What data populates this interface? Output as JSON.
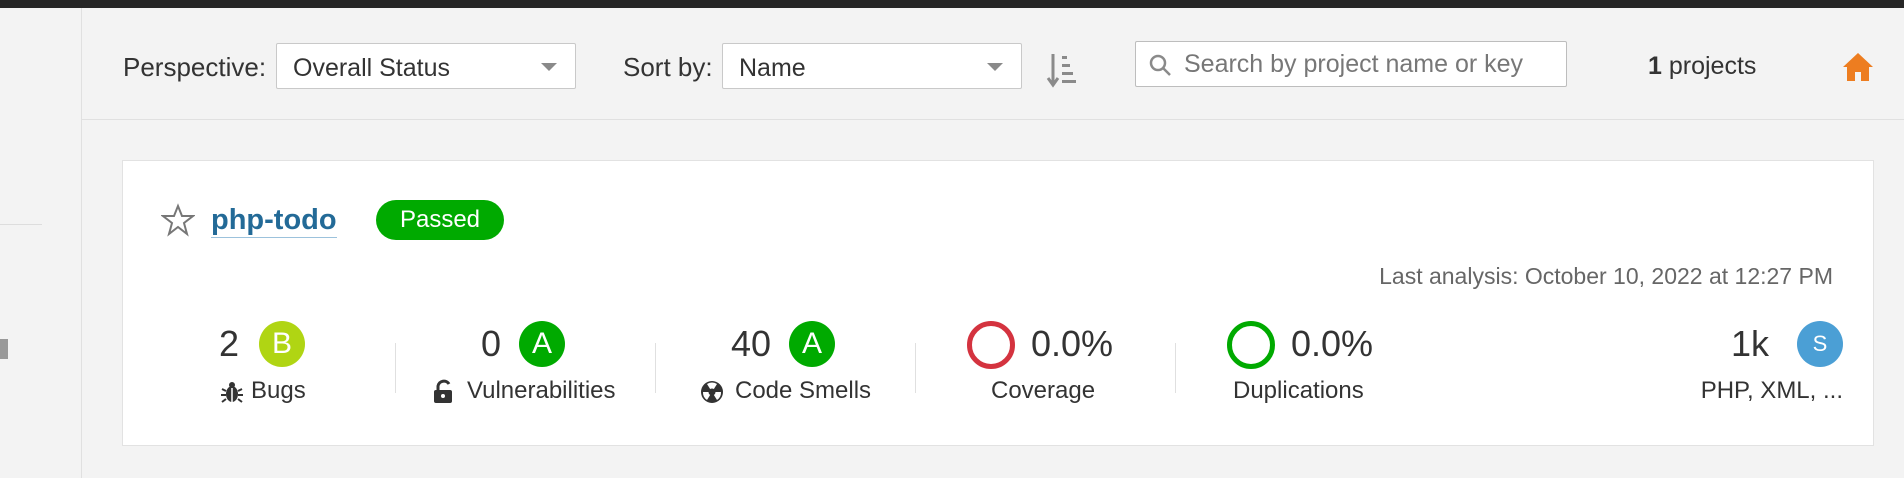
{
  "filterbar": {
    "perspective_label": "Perspective:",
    "perspective_value": "Overall Status",
    "sortby_label": "Sort by:",
    "sortby_value": "Name",
    "sort_icon": "sort-ascending-icon",
    "search_placeholder": "Search by project name or key",
    "projects_count": "1",
    "projects_suffix": "projects",
    "home_icon": "home-icon"
  },
  "project": {
    "name": "php-todo",
    "quality_gate": "Passed",
    "last_analysis": "Last analysis: October 10, 2022 at 12:27 PM",
    "metrics": {
      "bugs": {
        "value": "2",
        "rating": "B",
        "label": "Bugs"
      },
      "vulnerabilities": {
        "value": "0",
        "rating": "A",
        "label": "Vulnerabilities"
      },
      "code_smells": {
        "value": "40",
        "rating": "A",
        "label": "Code Smells"
      },
      "coverage": {
        "value": "0.0%",
        "label": "Coverage"
      },
      "duplications": {
        "value": "0.0%",
        "label": "Duplications"
      },
      "size": {
        "value": "1k",
        "rating": "S",
        "label": "PHP, XML, ..."
      }
    }
  },
  "colors": {
    "passed": "#00aa00",
    "rating_a": "#00aa00",
    "rating_b": "#b0d513",
    "size_badge": "#4b9fd5",
    "coverage_ring": "#d4333f",
    "duplications_ring": "#00aa00",
    "link": "#236a97",
    "home": "#ed7d20"
  }
}
